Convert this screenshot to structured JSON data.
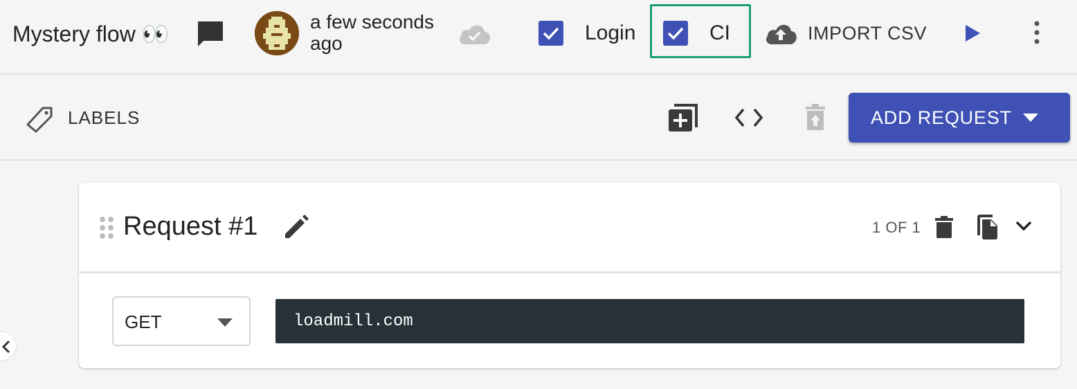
{
  "header": {
    "flow_title": "Mystery flow 👀",
    "updated_text": "a few seconds ago",
    "login_label": "Login",
    "login_checked": true,
    "ci_label": "CI",
    "ci_checked": true,
    "import_label": "IMPORT CSV"
  },
  "toolbar": {
    "labels_label": "LABELS",
    "add_request_label": "ADD REQUEST"
  },
  "request": {
    "title": "Request #1",
    "pager": "1 OF 1",
    "method": "GET",
    "url": "loadmill.com"
  },
  "colors": {
    "accent": "#3f51b5",
    "ci_highlight": "#1aa06d",
    "url_bg": "#263238",
    "background": "#f5f5f5"
  },
  "icons": [
    "comment-icon",
    "avatar",
    "cloud-check-icon",
    "cloud-upload-icon",
    "play-icon",
    "more-vert-icon",
    "tag-icon",
    "add-box-icon",
    "code-icon",
    "trash-upload-icon",
    "drag-handle-icon",
    "pencil-icon",
    "trash-icon",
    "copy-icon",
    "chevron-down-icon",
    "chevron-left-icon"
  ]
}
